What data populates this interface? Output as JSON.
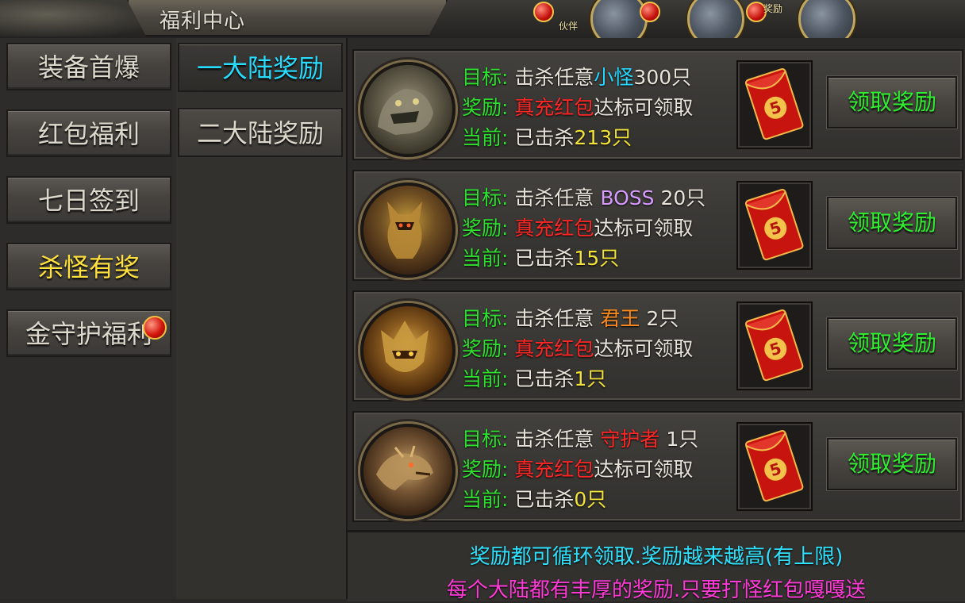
{
  "window": {
    "title": "福利中心"
  },
  "hud": {
    "badge_text": "奖励",
    "left_label": "伙伴"
  },
  "categories": [
    {
      "label": "装备首爆",
      "active": false
    },
    {
      "label": "红包福利",
      "active": false
    },
    {
      "label": "七日签到",
      "active": false
    },
    {
      "label": "杀怪有奖",
      "active": true
    },
    {
      "label": "金守护福利",
      "active": false,
      "badge": true
    }
  ],
  "subtabs": [
    {
      "label": "一大陆奖励",
      "active": true
    },
    {
      "label": "二大陆奖励",
      "active": false
    }
  ],
  "tasks": [
    {
      "target_label": "目标:",
      "target_prefix": "击杀任意",
      "target_name": "小怪",
      "target_name_color": "cyan",
      "target_count": "300只",
      "reward_label": "奖励:",
      "reward_name": "真充红包",
      "reward_suffix": "达标可领取",
      "current_label": "当前:",
      "current_prefix": "已击杀",
      "current_value": "213只",
      "redpack_value": "5",
      "claim_label": "领取奖励",
      "portrait_icon": "beast-portrait-icon"
    },
    {
      "target_label": "目标:",
      "target_prefix": "击杀任意",
      "target_name": "BOSS",
      "target_name_color": "purple",
      "target_count": "20只",
      "reward_label": "奖励:",
      "reward_name": "真充红包",
      "reward_suffix": "达标可领取",
      "current_label": "当前:",
      "current_prefix": "已击杀",
      "current_value": "15只",
      "redpack_value": "5",
      "claim_label": "领取奖励",
      "portrait_icon": "boss-portrait-icon"
    },
    {
      "target_label": "目标:",
      "target_prefix": "击杀任意",
      "target_name": "君王",
      "target_name_color": "orange",
      "target_count": "2只",
      "reward_label": "奖励:",
      "reward_name": "真充红包",
      "reward_suffix": "达标可领取",
      "current_label": "当前:",
      "current_prefix": "已击杀",
      "current_value": "1只",
      "redpack_value": "5",
      "claim_label": "领取奖励",
      "portrait_icon": "king-portrait-icon"
    },
    {
      "target_label": "目标:",
      "target_prefix": "击杀任意",
      "target_name": "守护者",
      "target_name_color": "red",
      "target_count": "1只",
      "reward_label": "奖励:",
      "reward_name": "真充红包",
      "reward_suffix": "达标可领取",
      "current_label": "当前:",
      "current_prefix": "已击杀",
      "current_value": "0只",
      "redpack_value": "5",
      "claim_label": "领取奖励",
      "portrait_icon": "dragon-portrait-icon"
    }
  ],
  "footer": {
    "line1": "奖励都可循环领取.奖励越来越高(有上限)",
    "line2": "每个大陆都有丰厚的奖励.只要打怪红包嘎嘎送"
  },
  "colors": {
    "label_green": "#2ee02e",
    "highlight_red": "#ff2626",
    "monster_cyan": "#26d6ff",
    "boss_purple": "#d79aff",
    "king_orange": "#ff8a1c",
    "count_yellow": "#f2e23a",
    "active_tab_cyan": "#27dcff",
    "active_cat_yellow": "#ffe03c",
    "footer_cyan": "#2ee2ff",
    "footer_magenta": "#ff3ad6"
  }
}
